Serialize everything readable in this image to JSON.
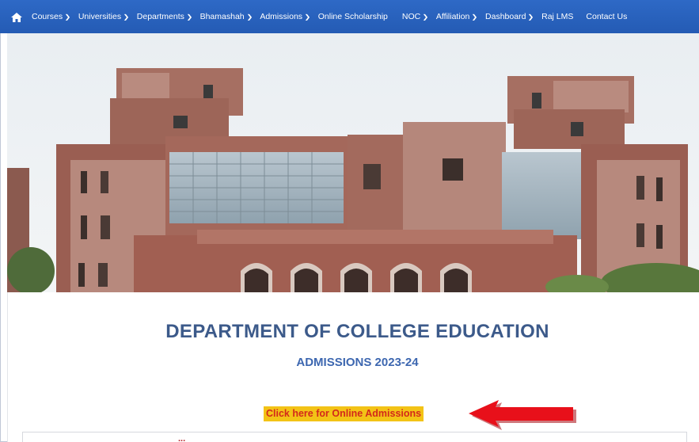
{
  "nav": {
    "home_icon": "home-icon",
    "items": [
      {
        "label": "Courses",
        "dropdown": true
      },
      {
        "label": "Universities",
        "dropdown": true
      },
      {
        "label": "Departments",
        "dropdown": true
      },
      {
        "label": "Bhamashah",
        "dropdown": true
      },
      {
        "label": "Admissions",
        "dropdown": true
      },
      {
        "label": "Online Scholarship",
        "dropdown": false
      },
      {
        "label": "NOC",
        "dropdown": true
      },
      {
        "label": "Affiliation",
        "dropdown": true
      },
      {
        "label": "Dashboard",
        "dropdown": true
      },
      {
        "label": "Raj LMS",
        "dropdown": false
      },
      {
        "label": "Contact Us",
        "dropdown": false
      }
    ],
    "color": "#2a62bf"
  },
  "main": {
    "title": "DEPARTMENT OF COLLEGE EDUCATION",
    "subtitle": "ADMISSIONS 2023-24",
    "admission_link": "Click here for Online Admissions",
    "bottom_text": "...",
    "title_color": "#3c5a8a",
    "link_bg": "#f3c316",
    "link_color": "#d3291b",
    "arrow_color": "#e8101a"
  }
}
